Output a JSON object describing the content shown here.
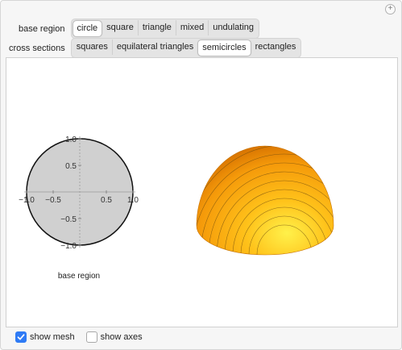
{
  "controls": {
    "base_region": {
      "label": "base region",
      "options": [
        "circle",
        "square",
        "triangle",
        "mixed",
        "undulating"
      ],
      "selected": "circle"
    },
    "cross_sections": {
      "label": "cross sections",
      "options": [
        "squares",
        "equilateral triangles",
        "semicircles",
        "rectangles"
      ],
      "selected": "semicircles"
    }
  },
  "plot2d": {
    "x_ticks": [
      "−1.0",
      "−0.5",
      "0.5",
      "1.0"
    ],
    "y_ticks": [
      "1.0",
      "0.5",
      "−0.5",
      "−1.0"
    ],
    "caption": "base region",
    "fill_color": "#d0d0d0"
  },
  "solid": {
    "colors": [
      "#fff14a",
      "#ffc21a",
      "#f59a0a",
      "#d46f00"
    ]
  },
  "checkboxes": [
    {
      "label": "show mesh",
      "checked": true
    },
    {
      "label": "show axes",
      "checked": false
    }
  ],
  "icons": {
    "expand": "plus-icon",
    "check": "checkmark-icon"
  }
}
